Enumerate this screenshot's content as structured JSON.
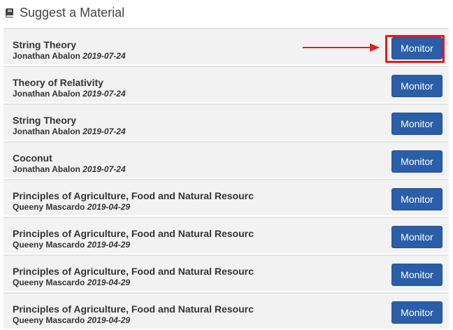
{
  "header": {
    "title": "Suggest a Material",
    "icon": "book-icon"
  },
  "materials": [
    {
      "title": "String Theory",
      "author": "Jonathan Abalon",
      "date": "2019-07-24",
      "button": "Monitor"
    },
    {
      "title": "Theory of Relativity",
      "author": "Jonathan Abalon",
      "date": "2019-07-24",
      "button": "Monitor"
    },
    {
      "title": "String Theory",
      "author": "Jonathan Abalon",
      "date": "2019-07-24",
      "button": "Monitor"
    },
    {
      "title": "Coconut",
      "author": "Jonathan Abalon",
      "date": "2019-07-24",
      "button": "Monitor"
    },
    {
      "title": "Principles of Agriculture, Food and Natural Resourc",
      "author": "Queeny Mascardo",
      "date": "2019-04-29",
      "button": "Monitor"
    },
    {
      "title": "Principles of Agriculture, Food and Natural Resourc",
      "author": "Queeny Mascardo",
      "date": "2019-04-29",
      "button": "Monitor"
    },
    {
      "title": "Principles of Agriculture, Food and Natural Resourc",
      "author": "Queeny Mascardo",
      "date": "2019-04-29",
      "button": "Monitor"
    },
    {
      "title": "Principles of Agriculture, Food and Natural Resourc",
      "author": "Queeny Mascardo",
      "date": "2019-04-29",
      "button": "Monitor"
    }
  ],
  "annotation": {
    "color": "#e51c1c",
    "target_row": 1
  },
  "colors": {
    "button": "#2a5ea8",
    "row_bg": "#f2f2f2"
  }
}
